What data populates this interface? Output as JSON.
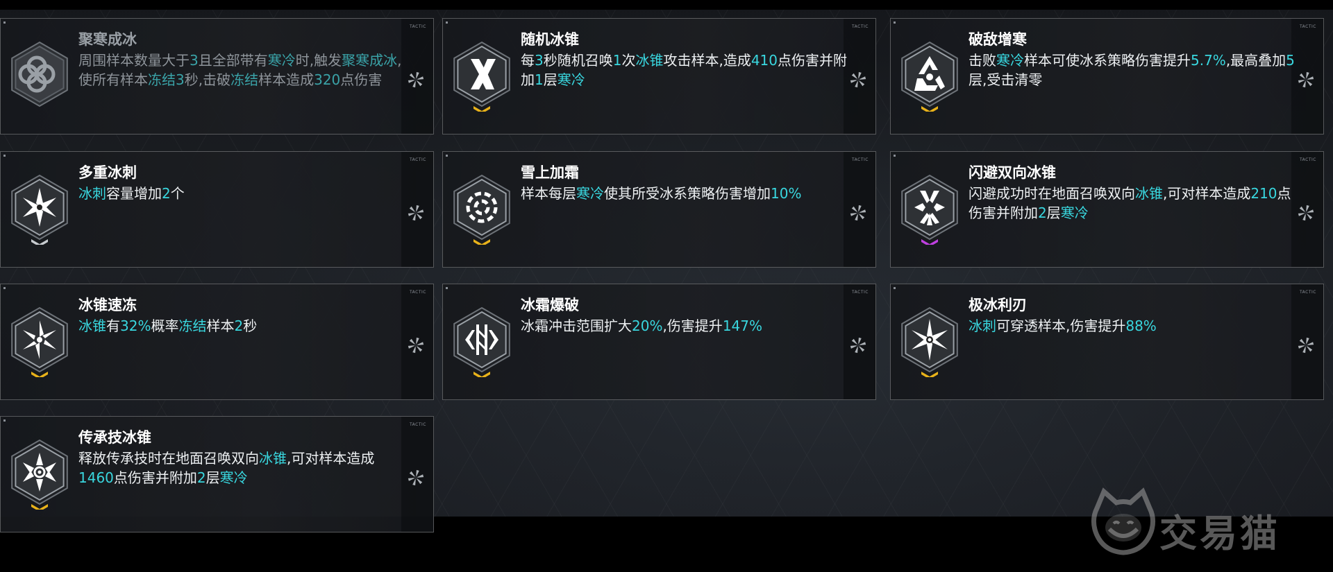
{
  "accent_color": "#39d7df",
  "tactic_label": "TACTIC",
  "watermark": {
    "text": "交易猫",
    "icon": "cat-logo-icon"
  },
  "cards": [
    {
      "title": "聚寒成冰",
      "dimmed": true,
      "rarity": "none",
      "icon": "ring-knot-icon",
      "desc": [
        [
          "t",
          "周围样本数量大于"
        ],
        [
          "h",
          "3"
        ],
        [
          "t",
          "且全部带有"
        ],
        [
          "h",
          "寒冷"
        ],
        [
          "t",
          "时,触发"
        ],
        [
          "h",
          "聚寒成冰"
        ],
        [
          "t",
          ",使所有样本"
        ],
        [
          "h",
          "冻结3"
        ],
        [
          "t",
          "秒,击破"
        ],
        [
          "h",
          "冻结"
        ],
        [
          "t",
          "样本造成"
        ],
        [
          "h",
          "320"
        ],
        [
          "t",
          "点伤害"
        ]
      ]
    },
    {
      "title": "随机冰锥",
      "dimmed": false,
      "rarity": "gold",
      "icon": "ice-shards-icon",
      "desc": [
        [
          "t",
          "每"
        ],
        [
          "h",
          "3"
        ],
        [
          "t",
          "秒随机召唤"
        ],
        [
          "h",
          "1"
        ],
        [
          "t",
          "次"
        ],
        [
          "h",
          "冰锥"
        ],
        [
          "t",
          "攻击样本,造成"
        ],
        [
          "h",
          "410"
        ],
        [
          "t",
          "点伤害并附加"
        ],
        [
          "h",
          "1"
        ],
        [
          "t",
          "层"
        ],
        [
          "h",
          "寒冷"
        ]
      ]
    },
    {
      "title": "破敌增寒",
      "dimmed": false,
      "rarity": "gold",
      "icon": "triangle-arrows-icon",
      "desc": [
        [
          "t",
          "击败"
        ],
        [
          "h",
          "寒冷"
        ],
        [
          "t",
          "样本可使冰系策略伤害提升"
        ],
        [
          "h",
          "5.7%"
        ],
        [
          "t",
          ",最高叠加"
        ],
        [
          "h",
          "5"
        ],
        [
          "t",
          "层,受击清零"
        ]
      ]
    },
    {
      "title": "多重冰刺",
      "dimmed": false,
      "rarity": "silver",
      "icon": "snow-star-icon",
      "desc": [
        [
          "h",
          "冰刺"
        ],
        [
          "t",
          "容量增加"
        ],
        [
          "h",
          "2"
        ],
        [
          "t",
          "个"
        ]
      ]
    },
    {
      "title": "雪上加霜",
      "dimmed": false,
      "rarity": "gold",
      "icon": "frost-ring-icon",
      "desc": [
        [
          "t",
          "样本每层"
        ],
        [
          "h",
          "寒冷"
        ],
        [
          "t",
          "使其所受冰系策略伤害增加"
        ],
        [
          "h",
          "10%"
        ]
      ]
    },
    {
      "title": "闪避双向冰锥",
      "dimmed": false,
      "rarity": "purple",
      "icon": "split-snowflake-icon",
      "desc": [
        [
          "t",
          "闪避成功时在地面召唤双向"
        ],
        [
          "h",
          "冰锥"
        ],
        [
          "t",
          ",可对样本造成"
        ],
        [
          "h",
          "210"
        ],
        [
          "t",
          "点伤害并附加"
        ],
        [
          "h",
          "2"
        ],
        [
          "t",
          "层"
        ],
        [
          "h",
          "寒冷"
        ]
      ]
    },
    {
      "title": "冰锥速冻",
      "dimmed": false,
      "rarity": "gold",
      "icon": "pinwheel-icon",
      "desc": [
        [
          "h",
          "冰锥"
        ],
        [
          "t",
          "有"
        ],
        [
          "h",
          "32%"
        ],
        [
          "t",
          "概率"
        ],
        [
          "h",
          "冻结"
        ],
        [
          "t",
          "样本"
        ],
        [
          "h",
          "2"
        ],
        [
          "t",
          "秒"
        ]
      ]
    },
    {
      "title": "冰霜爆破",
      "dimmed": false,
      "rarity": "gold",
      "icon": "frost-burst-icon",
      "desc": [
        [
          "t",
          "冰霜冲击范围扩大"
        ],
        [
          "h",
          "20%"
        ],
        [
          "t",
          ",伤害提升"
        ],
        [
          "h",
          "147%"
        ]
      ]
    },
    {
      "title": "极冰利刃",
      "dimmed": false,
      "rarity": "gold",
      "icon": "blade-star-icon",
      "desc": [
        [
          "h",
          "冰刺"
        ],
        [
          "t",
          "可穿透样本,伤害提升"
        ],
        [
          "h",
          "88%"
        ]
      ]
    },
    {
      "title": "传承技冰锥",
      "dimmed": false,
      "rarity": "gold",
      "icon": "core-snowflake-icon",
      "desc": [
        [
          "t",
          "释放传承技时在地面召唤双向"
        ],
        [
          "h",
          "冰锥"
        ],
        [
          "t",
          ",可对样本造成"
        ],
        [
          "h",
          "1460"
        ],
        [
          "t",
          "点伤害并附加"
        ],
        [
          "h",
          "2"
        ],
        [
          "t",
          "层"
        ],
        [
          "h",
          "寒冷"
        ]
      ]
    }
  ],
  "rarity_colors": {
    "gold": "#e8b21a",
    "silver": "#c8ccd0",
    "purple": "#c040e0",
    "none": "transparent"
  }
}
